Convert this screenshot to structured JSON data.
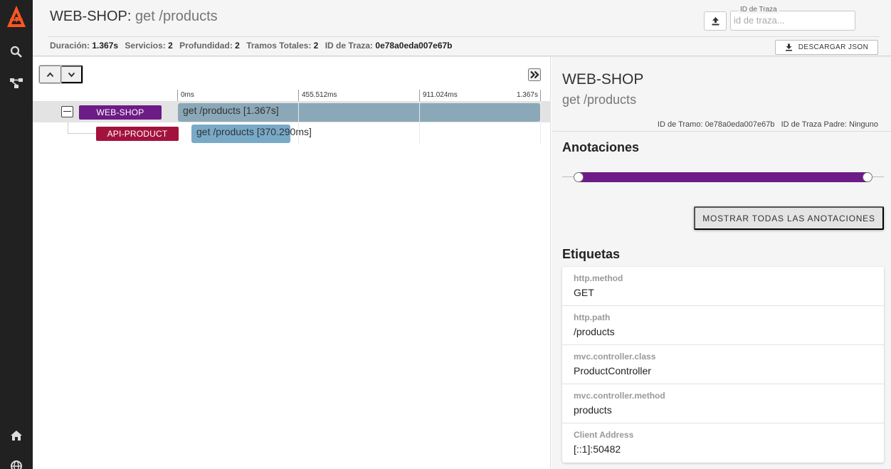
{
  "colors": {
    "rail_bg": "#212121",
    "logo_orange": "#ff5722",
    "web_shop_chip": "#6d1b86",
    "api_product_chip": "#a3123d",
    "span_bar": "#8aa8b8",
    "slider_fill": "#6d1b86"
  },
  "rail": {
    "icons": [
      "logo-icon",
      "search-icon",
      "dependencies-icon",
      "home-icon",
      "globe-icon"
    ]
  },
  "header": {
    "service": "WEB-SHOP",
    "separator": ": ",
    "operation": "get /products",
    "trace_field_label": "ID de Traza",
    "trace_field_placeholder": "id de traza...",
    "download_label": "DESCARGAR JSON",
    "summary": {
      "duration_key": "Duración:",
      "duration_val": "1.367s",
      "services_key": "Servicios:",
      "services_val": "2",
      "depth_key": "Profundidad:",
      "depth_val": "2",
      "spans_key": "Tramos Totales:",
      "spans_val": "2",
      "trace_key": "ID de Traza:",
      "trace_val": "0e78a0eda007e67b"
    }
  },
  "timeline": {
    "ticks": [
      "0ms",
      "455.512ms",
      "911.024ms",
      "1.367s"
    ],
    "rows": [
      {
        "service": "WEB-SHOP",
        "label": "get /products [1.367s]"
      },
      {
        "service": "API-PRODUCT",
        "label": "get /products [370.290ms]"
      }
    ]
  },
  "detail": {
    "service": "WEB-SHOP",
    "operation": "get /products",
    "span_id_key": "ID de Tramo:",
    "span_id_val": "0e78a0eda007e67b",
    "parent_key": "ID de Traza Padre:",
    "parent_val": "Ninguno",
    "annotations_title": "Anotaciones",
    "show_all_label": "MOSTRAR TODAS LAS ANOTACIONES",
    "tags_title": "Etiquetas",
    "tags": [
      {
        "key": "http.method",
        "value": "GET"
      },
      {
        "key": "http.path",
        "value": "/products"
      },
      {
        "key": "mvc.controller.class",
        "value": "ProductController"
      },
      {
        "key": "mvc.controller.method",
        "value": "products"
      },
      {
        "key": "Client Address",
        "value": "[::1]:50482"
      }
    ]
  }
}
